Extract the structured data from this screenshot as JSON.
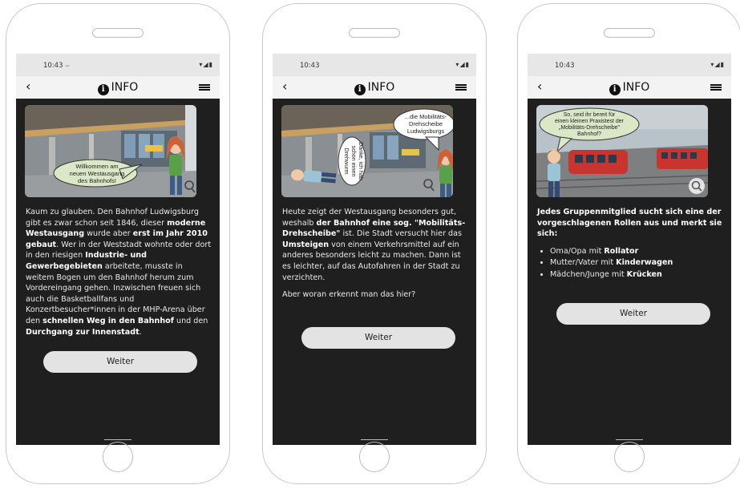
{
  "screens": [
    {
      "time": "10:43 ⌣",
      "title": "INFO",
      "bubble": [
        "Willkommen am",
        "neuen Westausgang",
        "des Bahnhofs!"
      ],
      "text": [
        {
          "t": "Kaum zu glauben. Den Bahnhof Ludwigsburg gibt es zwar schon seit 1846, dieser "
        },
        {
          "t": "moderne Westausgang",
          "b": true
        },
        {
          "t": " wurde aber "
        },
        {
          "t": "erst im Jahr 2010 gebaut",
          "b": true
        },
        {
          "t": ". Wer in der Weststadt wohnte oder dort in den riesigen "
        },
        {
          "t": "Industrie- und Gewerbegebieten",
          "b": true
        },
        {
          "t": " arbeitete, musste in weitem Bogen um den Bahnhof herum zum Vordereingang gehen. Inzwischen freuen sich auch die Basketballfans und Konzertbesucher*innen in der MHP-Arena über den "
        },
        {
          "t": "schnellen Weg in den Bahnhof",
          "b": true
        },
        {
          "t": " und den "
        },
        {
          "t": "Durchgang zur Innenstadt",
          "b": true
        },
        {
          "t": "."
        }
      ],
      "button": "Weiter"
    },
    {
      "time": "10:43",
      "title": "INFO",
      "bubble": [
        "...die Mobilitäts-",
        "Drehscheibe",
        "Ludwigsburgs"
      ],
      "bubble2": [
        "Danke, ich hab",
        "schon einen",
        "Drehwurm"
      ],
      "text": [
        {
          "t": "Heute zeigt der Westausgang besonders gut, weshalb "
        },
        {
          "t": "der Bahnhof eine sog. \"Mobilitäts-Drehscheibe\"",
          "b": true
        },
        {
          "t": " ist. Die Stadt versucht hier das "
        },
        {
          "t": "Umsteigen",
          "b": true
        },
        {
          "t": " von einem Verkehrsmittel auf ein anderes besonders leicht zu machen. Dann ist es leichter, auf das Autofahren in der Stadt zu verzichten."
        }
      ],
      "question": "Aber woran erkennt man das hier?",
      "button": "Weiter"
    },
    {
      "time": "10:43",
      "title": "INFO",
      "bubble": [
        "So, seid ihr bereit für",
        "einen kleinen Praxistest der",
        "„Mobilitäts-Drehscheibe\"",
        "Bahnhof?"
      ],
      "intro": "Jedes Gruppenmitglied sucht sich eine der vorgeschlagenen Rollen aus und merkt sie sich:",
      "roles": [
        {
          "prefix": "Oma/Opa mit ",
          "item": "Rollator"
        },
        {
          "prefix": "Mutter/Vater mit ",
          "item": "Kinderwagen"
        },
        {
          "prefix": "Mädchen/Junge mit ",
          "item": "Krücken"
        }
      ],
      "button": "Weiter"
    }
  ],
  "icons": {
    "back": "chevron-left-icon",
    "info": "info-icon",
    "menu": "hamburger-menu-icon",
    "zoom": "magnifier-icon",
    "signal": "wifi-signal-battery-icon"
  },
  "colors": {
    "screen_bg": "#1f1f1f",
    "button_bg": "#e3e3e3",
    "nav_bg": "#f3f3f3",
    "status_bg": "#e7e7e7"
  }
}
